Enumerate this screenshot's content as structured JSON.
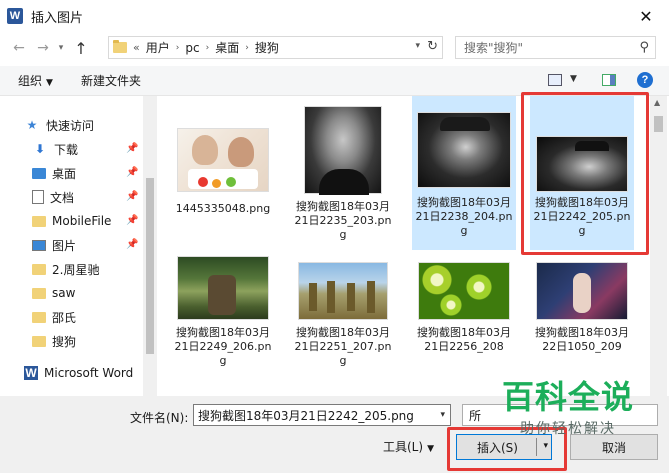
{
  "window": {
    "title": "插入图片",
    "app_icon": "W"
  },
  "nav": {
    "back_icon": "←",
    "forward_icon": "→",
    "recent_icon": "▾",
    "up_icon": "↑",
    "breadcrumb": [
      "用户",
      "pc",
      "桌面",
      "搜狗"
    ],
    "crumb_prefix": "«",
    "search_placeholder": "搜索\"搜狗\""
  },
  "toolbar": {
    "organize": "组织",
    "new_folder": "新建文件夹",
    "help": "?"
  },
  "sidebar": {
    "items": [
      {
        "label": "快速访问",
        "icon": "star-icon",
        "pinned": false
      },
      {
        "label": "下载",
        "icon": "download-icon",
        "pinned": true
      },
      {
        "label": "桌面",
        "icon": "desktop-icon",
        "pinned": true
      },
      {
        "label": "文档",
        "icon": "document-icon",
        "pinned": true
      },
      {
        "label": "MobileFile",
        "icon": "folder-icon",
        "pinned": true
      },
      {
        "label": "图片",
        "icon": "pictures-icon",
        "pinned": true
      },
      {
        "label": "2.周星驰",
        "icon": "folder-icon",
        "pinned": false
      },
      {
        "label": "saw",
        "icon": "folder-icon",
        "pinned": false
      },
      {
        "label": "邵氏",
        "icon": "folder-icon",
        "pinned": false
      },
      {
        "label": "搜狗",
        "icon": "folder-icon",
        "pinned": false
      },
      {
        "label": "Microsoft Word",
        "icon": "word-icon",
        "pinned": false
      }
    ]
  },
  "files": [
    {
      "name": "1445335048.png",
      "selected": false
    },
    {
      "name": "搜狗截图18年03月21日2235_203.png",
      "selected": false
    },
    {
      "name": "搜狗截图18年03月21日2238_204.png",
      "selected": true
    },
    {
      "name": "搜狗截图18年03月21日2242_205.png",
      "selected": true
    },
    {
      "name": "搜狗截图18年03月21日2249_206.png",
      "selected": false
    },
    {
      "name": "搜狗截图18年03月21日2251_207.png",
      "selected": false
    },
    {
      "name": "搜狗截图18年03月21日2256_208",
      "selected": false
    },
    {
      "name": "搜狗截图18年03月22日1050_209",
      "selected": false
    }
  ],
  "footer": {
    "filename_label": "文件名(N):",
    "filename_value": "搜狗截图18年03月21日2242_205.png",
    "type_value": "所",
    "tools": "工具(L)",
    "insert": "插入(S)",
    "cancel": "取消"
  },
  "watermark": {
    "main": "百科全说",
    "sub": "助你轻松解决"
  },
  "colors": {
    "selection": "#cce8ff",
    "highlight_box": "#e53935",
    "watermark": "#1cae5a",
    "accent": "#0078d7"
  }
}
